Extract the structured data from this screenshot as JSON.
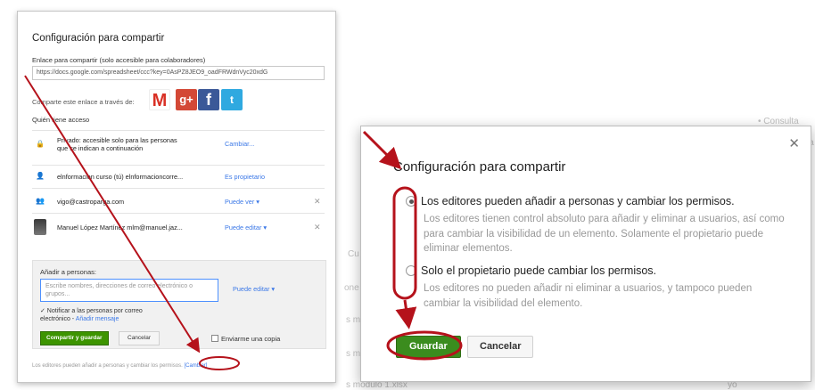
{
  "left_dialog": {
    "title": "Configuración para compartir",
    "link_label": "Enlace para compartir (solo accesible para colaboradores)",
    "link_url": "https://docs.google.com/spreadsheet/ccc?key=0AsPZ8JEO9_oadFRWdnVyc20xdG",
    "share_via_label": "Comparte este enlace a través de:",
    "share_icons": [
      "M",
      "g+",
      "f",
      "t"
    ],
    "access_label": "Quién tiene acceso",
    "access_rows": [
      {
        "icon": "🔒",
        "name": "Privado: accesible solo para las personas",
        "name2": "que se indican a continuación",
        "action": "Cambiar...",
        "remove": ""
      },
      {
        "icon": "👤",
        "name": "elnformacion curso (tú)  elnformacioncorre...",
        "name2": "",
        "action": "Es propietario",
        "remove": ""
      },
      {
        "icon": "👥",
        "name": "vigo@castroparga.com",
        "name2": "",
        "action": "Puede ver ▾",
        "remove": "✕"
      },
      {
        "icon": "",
        "name": "Manuel López Martínez  mlm@manuel.jaz...",
        "name2": "",
        "action": "Puede editar ▾",
        "remove": "✕"
      }
    ],
    "add_label": "Añadir a personas:",
    "add_placeholder": "Escribe nombres, direcciones de correo electrónico o grupos...",
    "add_permission": "Puede editar ▾",
    "notify_text": "✓ Notificar a las personas por correo",
    "notify_text2": "electrónico -",
    "notify_link": "Añadir mensaje",
    "share_button": "Compartir y guardar",
    "cancel_button": "Cancelar",
    "send_copy": "Enviarme una copia",
    "footer_text": "Los editores pueden añadir a personas y cambiar los permisos.",
    "footer_link": "[Cambiar]"
  },
  "background": {
    "consult": "•  Consulta",
    "la": "la",
    "cu": "Cu",
    "one": "one",
    "s_m1": "s m",
    "s_m2": "s m",
    "modulo": "s modulo 1.xlsx",
    "yo": "yo"
  },
  "right_dialog": {
    "title": "Configuración para compartir",
    "close": "✕",
    "options": [
      {
        "head": "Los editores pueden añadir a personas y cambiar los permisos.",
        "desc": "Los editores tienen control absoluto para añadir y eliminar a usuarios, así como para cambiar la visibilidad de un elemento. Solamente el propietario puede eliminar elementos.",
        "selected": true
      },
      {
        "head": "Solo el propietario puede cambiar los permisos.",
        "desc": "Los editores no pueden añadir ni eliminar a usuarios, y tampoco pueden cambiar la visibilidad del elemento.",
        "selected": false
      }
    ],
    "save_button": "Guardar",
    "cancel_button": "Cancelar"
  },
  "colors": {
    "annotation": "#b5121b",
    "primary_green": "#3b8c1e",
    "link_blue": "#3b78e7"
  }
}
